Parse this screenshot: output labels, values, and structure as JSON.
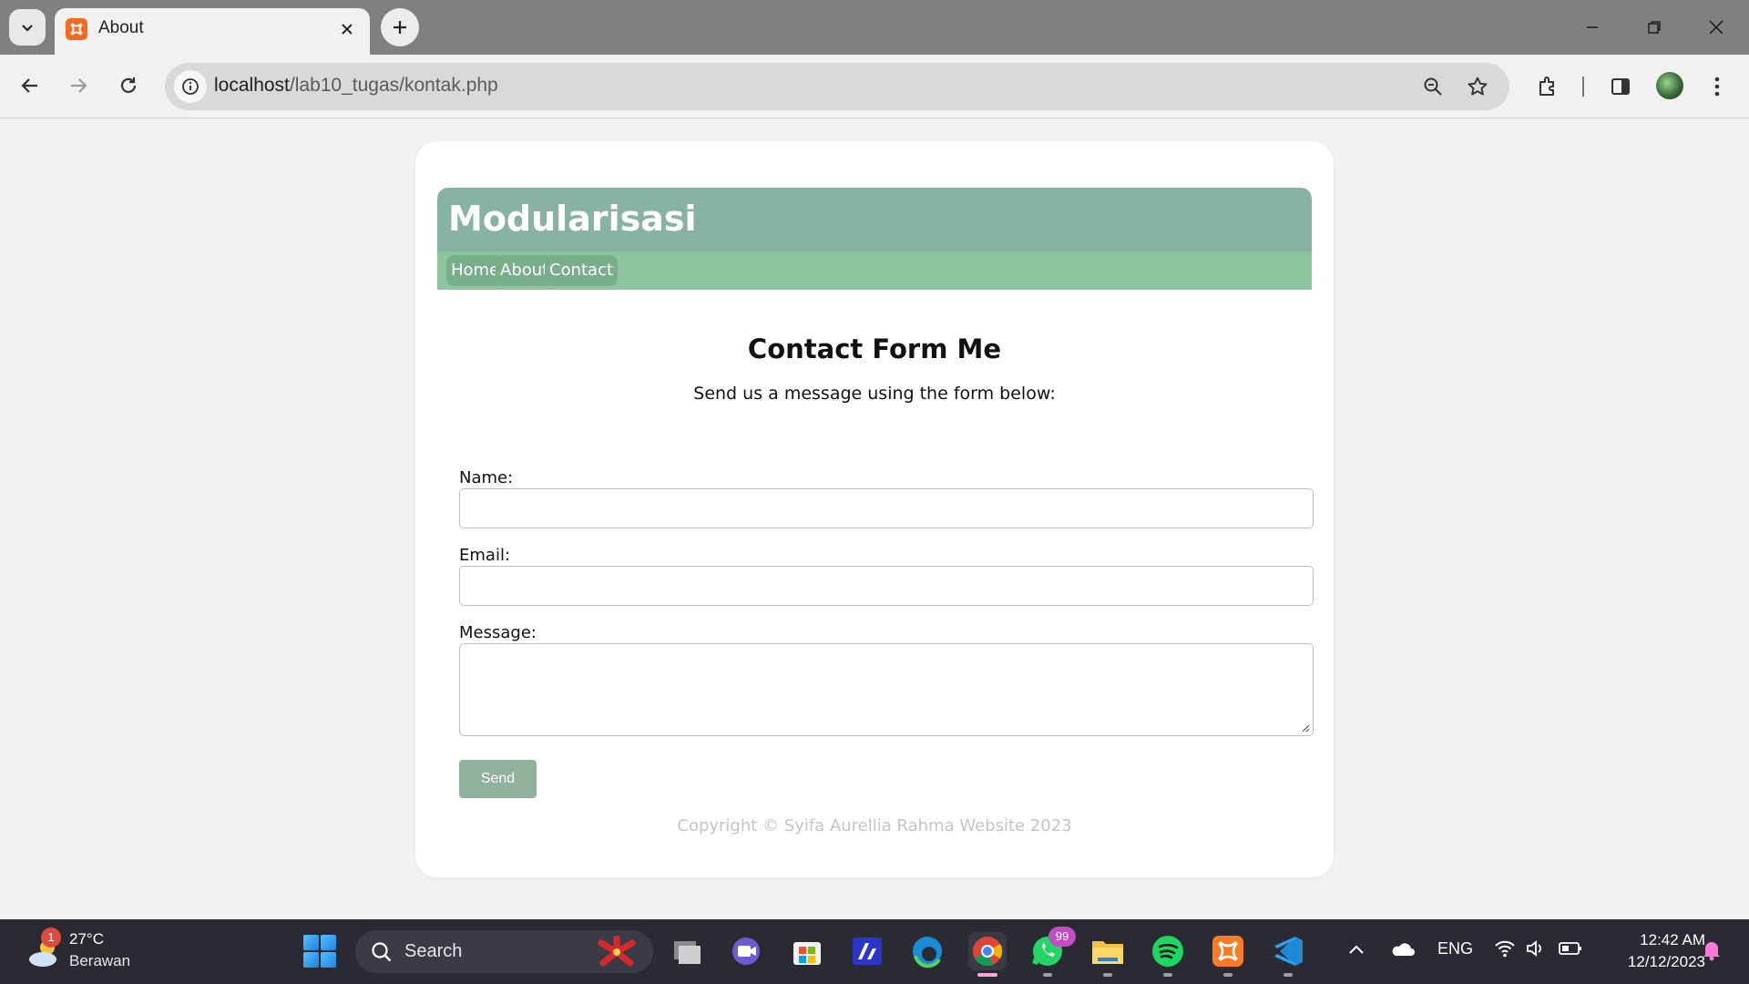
{
  "browser": {
    "tab_title": "About",
    "url_host": "localhost",
    "url_path": "/lab10_tugas/kontak.php"
  },
  "site": {
    "title": "Modularisasi",
    "nav": [
      "Home",
      "About",
      "Contact"
    ]
  },
  "contact": {
    "heading": "Contact Form Me",
    "subheading": "Send us a message using the form below:",
    "name_label": "Name:",
    "name_value": "",
    "email_label": "Email:",
    "email_value": "",
    "message_label": "Message:",
    "message_value": "",
    "send_label": "Send"
  },
  "footer": {
    "copyright": "Copyright © Syifa Aurellia Rahma Website 2023"
  },
  "taskbar": {
    "weather_badge": "1",
    "weather_temp": "27°C",
    "weather_desc": "Berawan",
    "search_label": "Search",
    "whatsapp_badge": "99",
    "language": "ENG",
    "time": "12:42 AM",
    "date": "12/12/2023"
  },
  "colors": {
    "header": "#88b3a2",
    "nav_bar": "#8dc4a0",
    "nav_pill": "#79ad8c",
    "send_button": "#8fb19d",
    "taskbar": "#2a2a33"
  },
  "icons": {
    "taskbar_apps": [
      "file-explorer-icon",
      "meet-icon",
      "microsoft-store-icon",
      "editor-icon",
      "edge-icon",
      "chrome-icon",
      "whatsapp-icon",
      "folder-icon",
      "spotify-icon",
      "xampp-icon",
      "vscode-icon"
    ]
  }
}
